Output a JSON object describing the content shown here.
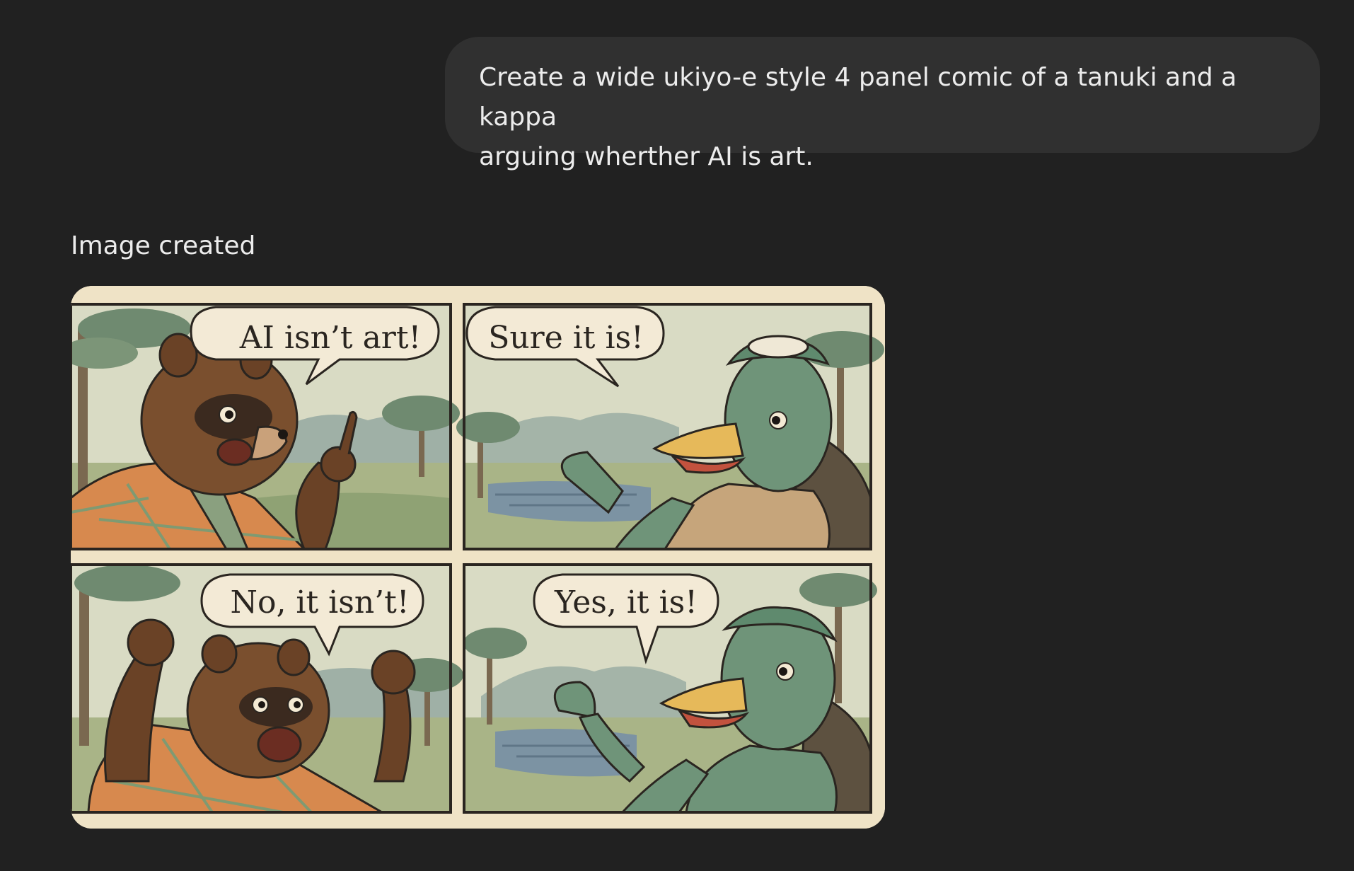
{
  "user_message": {
    "line1": "Create a wide ukiyo-e style 4 panel comic of a tanuki and a kappa",
    "line2": "arguing wherther AI is art."
  },
  "assistant": {
    "status": "Image created"
  },
  "comic": {
    "panels": [
      {
        "speech": "AI isn’t art!",
        "character": "tanuki"
      },
      {
        "speech": "Sure it is!",
        "character": "kappa"
      },
      {
        "speech": "No, it isn’t!",
        "character": "tanuki"
      },
      {
        "speech": "Yes, it is!",
        "character": "kappa"
      }
    ],
    "colors": {
      "paper": "#efe3c6",
      "ink": "#2a2520",
      "sky": "#d7d9c2",
      "tanuki_fur": "#7a4f2e",
      "kimono": "#d7894e",
      "kappa_skin": "#6f9479",
      "beak": "#e6b95a",
      "water": "#7c93a3"
    }
  }
}
